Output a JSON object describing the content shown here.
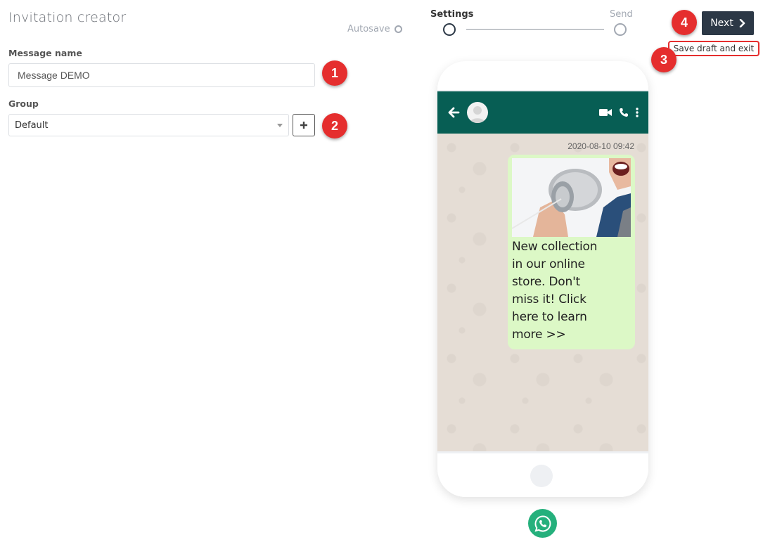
{
  "header": {
    "title": "Invitation creator",
    "autosave_label": "Autosave"
  },
  "stepper": {
    "steps": [
      {
        "label": "Settings",
        "active": true
      },
      {
        "label": "Send",
        "active": false
      }
    ]
  },
  "actions": {
    "next_label": "Next",
    "save_draft_label": "Save draft and exit"
  },
  "form": {
    "message_name_label": "Message name",
    "message_name_value": "Message DEMO",
    "group_label": "Group",
    "group_selected": "Default"
  },
  "badges": [
    "1",
    "2",
    "3",
    "4"
  ],
  "preview": {
    "timestamp": "2020-08-10 09:42",
    "message_text": "New collection in our online store. Don't miss it! Click here to learn more >>",
    "image_alt": "person shouting into tin can phone",
    "header_color": "#075e54",
    "bubble_color": "#dcf8c6",
    "chat_bg_color": "#e5ddd5"
  },
  "colors": {
    "primary_dark": "#2c3846",
    "annotation_red": "#e52e2e",
    "whatsapp_green": "#25b07c"
  }
}
